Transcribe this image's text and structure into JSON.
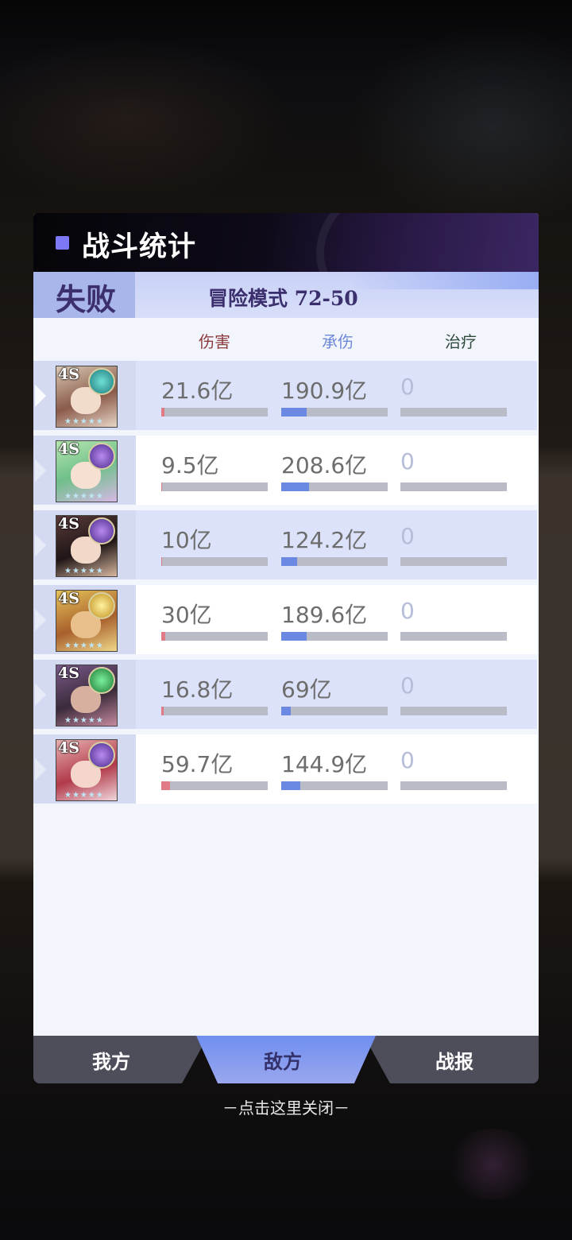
{
  "dialog": {
    "title": "战斗统计",
    "result": "失败",
    "stage": "冒险模式 72-50"
  },
  "columns": {
    "damage": "伤害",
    "tank": "承伤",
    "heal": "治疗"
  },
  "colors": {
    "damage_bar": "#e07a86",
    "tank_bar": "#6b89e3",
    "accent": "#7d79f6"
  },
  "heroes": [
    {
      "star": "4S",
      "element_icon": "wind-element-icon",
      "damage": "21.6亿",
      "tank": "190.9亿",
      "heal": "0",
      "damage_pct": 3,
      "tank_pct": 24,
      "heal_pct": 0
    },
    {
      "star": "4S",
      "element_icon": "dark-element-icon",
      "damage": "9.5亿",
      "tank": "208.6亿",
      "heal": "0",
      "damage_pct": 1,
      "tank_pct": 26,
      "heal_pct": 0
    },
    {
      "star": "4S",
      "element_icon": "dark-element-icon",
      "damage": "10亿",
      "tank": "124.2亿",
      "heal": "0",
      "damage_pct": 1,
      "tank_pct": 15,
      "heal_pct": 0
    },
    {
      "star": "4S",
      "element_icon": "light-element-icon",
      "damage": "30亿",
      "tank": "189.6亿",
      "heal": "0",
      "damage_pct": 4,
      "tank_pct": 24,
      "heal_pct": 0
    },
    {
      "star": "4S",
      "element_icon": "nature-element-icon",
      "damage": "16.8亿",
      "tank": "69亿",
      "heal": "0",
      "damage_pct": 2,
      "tank_pct": 9,
      "heal_pct": 0
    },
    {
      "star": "4S",
      "element_icon": "dark-element-icon",
      "damage": "59.7亿",
      "tank": "144.9亿",
      "heal": "0",
      "damage_pct": 8,
      "tank_pct": 18,
      "heal_pct": 0
    }
  ],
  "tabs": {
    "ours": "我方",
    "enemy": "敌方",
    "report": "战报"
  },
  "close_hint": "－点击这里关闭－"
}
